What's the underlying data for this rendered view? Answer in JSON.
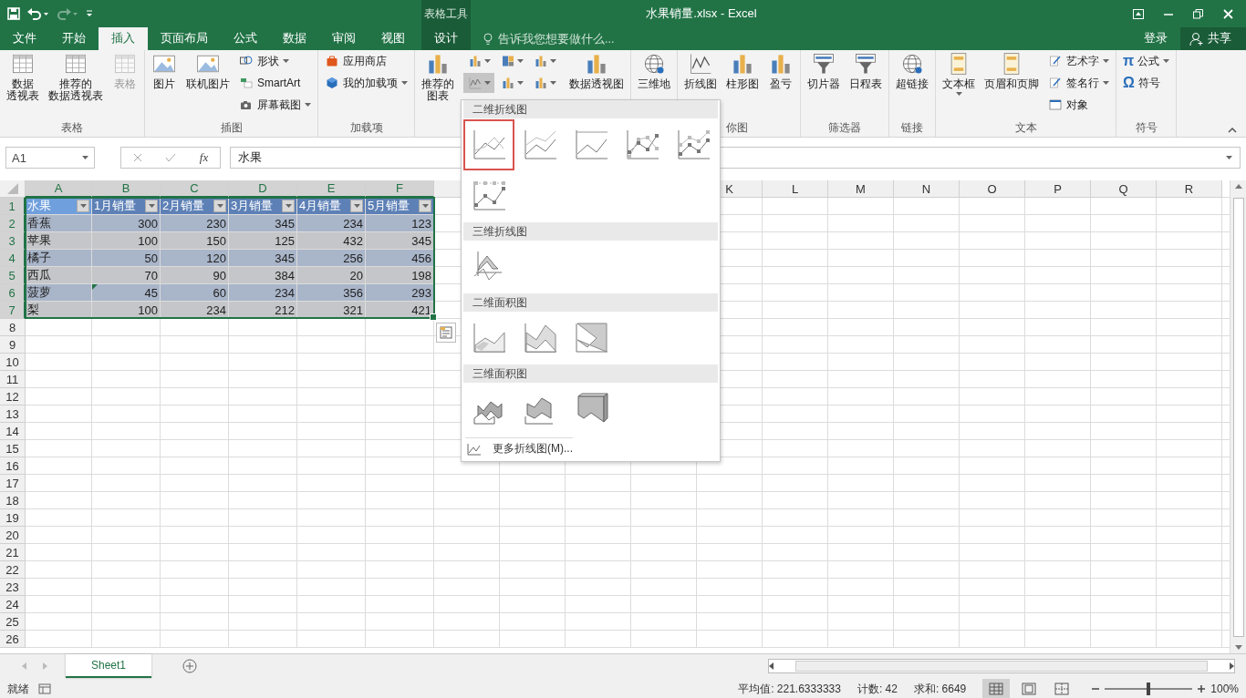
{
  "title_bar": {
    "quick_access": [
      {
        "kind": "save",
        "disabled": false
      },
      {
        "kind": "undo",
        "disabled": false
      },
      {
        "kind": "redo",
        "disabled": true
      },
      {
        "kind": "customize",
        "disabled": false
      }
    ],
    "context_label": "表格工具",
    "title": "水果销量.xlsx - Excel"
  },
  "tabs": [
    {
      "label": "文件",
      "selected": false,
      "kind": "normal"
    },
    {
      "label": "开始",
      "selected": false,
      "kind": "normal"
    },
    {
      "label": "插入",
      "selected": true,
      "kind": "normal"
    },
    {
      "label": "页面布局",
      "selected": false,
      "kind": "normal"
    },
    {
      "label": "公式",
      "selected": false,
      "kind": "normal"
    },
    {
      "label": "数据",
      "selected": false,
      "kind": "normal"
    },
    {
      "label": "审阅",
      "selected": false,
      "kind": "normal"
    },
    {
      "label": "视图",
      "selected": false,
      "kind": "normal"
    },
    {
      "label": "设计",
      "selected": false,
      "kind": "contextual"
    }
  ],
  "tell_me": {
    "placeholder": "告诉我您想要做什么..."
  },
  "sign_in": "登录",
  "share": "共享",
  "ribbon": [
    {
      "label": "表格",
      "items": [
        {
          "kind": "large",
          "lines": [
            "数据",
            "透视表"
          ],
          "disabled": false
        },
        {
          "kind": "large",
          "lines": [
            "推荐的",
            "数据透视表"
          ],
          "disabled": false
        },
        {
          "kind": "large",
          "lines": [
            "表格"
          ],
          "disabled": true
        }
      ]
    },
    {
      "label": "插图",
      "items": [
        {
          "kind": "large",
          "lines": [
            "图片"
          ]
        },
        {
          "kind": "large",
          "lines": [
            "联机图片"
          ]
        },
        {
          "kind": "stack",
          "entries": [
            {
              "label": "形状",
              "dropdown": true
            },
            {
              "label": "SmartArt",
              "dropdown": false
            },
            {
              "label": "屏幕截图",
              "dropdown": true
            }
          ]
        }
      ]
    },
    {
      "label": "加载项",
      "items": [
        {
          "kind": "stack",
          "entries": [
            {
              "label": "应用商店",
              "dropdown": false
            },
            {
              "label": "我的加载项",
              "dropdown": true
            }
          ]
        }
      ]
    },
    {
      "items": [
        {
          "kind": "large",
          "lines": [
            "推荐的",
            "图表"
          ]
        },
        {
          "kind": "grid",
          "buttons": [
            {
              "selected": false
            },
            {
              "selected": false
            },
            {
              "selected": false
            },
            {
              "selected": true
            },
            {
              "selected": false
            },
            {
              "selected": false
            }
          ]
        },
        {
          "kind": "large",
          "lines": [
            "数据透视图"
          ]
        }
      ]
    },
    {
      "items": [
        {
          "kind": "large",
          "lines": [
            "三维地"
          ]
        }
      ]
    },
    {
      "label": "你图",
      "label_cut": true,
      "items": [
        {
          "kind": "large",
          "lines": [
            "折线图"
          ]
        },
        {
          "kind": "large",
          "lines": [
            "柱形图"
          ]
        },
        {
          "kind": "large",
          "lines": [
            "盈亏"
          ]
        }
      ]
    },
    {
      "label": "筛选器",
      "items": [
        {
          "kind": "large",
          "lines": [
            "切片器"
          ]
        },
        {
          "kind": "large",
          "lines": [
            "日程表"
          ]
        }
      ]
    },
    {
      "label": "链接",
      "items": [
        {
          "kind": "large",
          "lines": [
            "超链接"
          ]
        }
      ]
    },
    {
      "label": "文本",
      "items": [
        {
          "kind": "large",
          "lines": [
            "文本框"
          ],
          "dropdown": true
        },
        {
          "kind": "large",
          "lines": [
            "页眉和页脚"
          ],
          "dropdown": false
        },
        {
          "kind": "stack",
          "entries": [
            {
              "label": "艺术字",
              "dropdown": true
            },
            {
              "label": "签名行",
              "dropdown": true
            },
            {
              "label": "对象",
              "dropdown": false
            }
          ]
        }
      ]
    },
    {
      "label": "符号",
      "items": [
        {
          "kind": "stack",
          "entries": [
            {
              "glyph": "π",
              "label": "公式",
              "dropdown": true
            },
            {
              "glyph": "Ω",
              "label": "符号",
              "dropdown": false
            }
          ]
        }
      ]
    }
  ],
  "formula_bar": {
    "name_box": "A1",
    "fx": "fx",
    "value": "水果"
  },
  "columns_left": [
    "A",
    "B",
    "C",
    "D",
    "E",
    "F"
  ],
  "columns_right": [
    "K",
    "L",
    "M",
    "N",
    "O",
    "P",
    "Q",
    "R"
  ],
  "row_numbers": [
    "1",
    "2",
    "3",
    "4",
    "5",
    "6",
    "7",
    "8",
    "9",
    "10",
    "11",
    "12",
    "13",
    "14",
    "15",
    "16",
    "17",
    "18",
    "19",
    "20",
    "21",
    "22",
    "23",
    "24",
    "25",
    "26"
  ],
  "table": {
    "headers": [
      "水果",
      "1月销量",
      "2月销量",
      "3月销量",
      "4月销量",
      "5月销量"
    ],
    "rows": [
      [
        "香蕉",
        "300",
        "230",
        "345",
        "234",
        "123"
      ],
      [
        "苹果",
        "100",
        "150",
        "125",
        "432",
        "345"
      ],
      [
        "橘子",
        "50",
        "120",
        "345",
        "256",
        "456"
      ],
      [
        "西瓜",
        "70",
        "90",
        "384",
        "20",
        "198"
      ],
      [
        "菠萝",
        {
          "text": "45",
          "error": true
        },
        "60",
        "234",
        "356",
        "293"
      ],
      [
        "梨",
        "100",
        "234",
        "212",
        "321",
        "421"
      ]
    ]
  },
  "chart_menu": {
    "sections": [
      {
        "title": "二维折线图",
        "options": [
          {
            "kind": "line",
            "selected": true
          },
          {
            "kind": "stacked-line",
            "selected": false
          },
          {
            "kind": "percent-line",
            "selected": false
          },
          {
            "kind": "line-markers",
            "selected": false
          },
          {
            "kind": "stacked-line-markers",
            "selected": false
          },
          {
            "kind": "percent-line-markers",
            "selected": false
          }
        ]
      },
      {
        "title": "三维折线图",
        "options": [
          {
            "kind": "ribbon",
            "selected": false
          }
        ]
      },
      {
        "title": "二维面积图",
        "options": [
          {
            "kind": "area",
            "selected": false
          },
          {
            "kind": "stacked-area",
            "selected": false
          },
          {
            "kind": "percent-area",
            "selected": false
          }
        ]
      },
      {
        "title": "三维面积图",
        "options": [
          {
            "kind": "area3d",
            "selected": false
          },
          {
            "kind": "stackedarea3d",
            "selected": false
          },
          {
            "kind": "percentarea3d",
            "selected": false
          }
        ]
      }
    ],
    "footer": "更多折线图(M)..."
  },
  "sheets": [
    {
      "name": "Sheet1",
      "selected": true
    }
  ],
  "status_bar": {
    "ready": "就绪",
    "average": "平均值: 221.6333333",
    "count": "计数: 42",
    "sum": "求和: 6649",
    "views": [
      {
        "kind": "normal",
        "selected": true
      },
      {
        "kind": "page-layout",
        "selected": false
      },
      {
        "kind": "page-break",
        "selected": false
      }
    ],
    "zoom": {
      "level": 0.5,
      "label": "100%"
    }
  }
}
